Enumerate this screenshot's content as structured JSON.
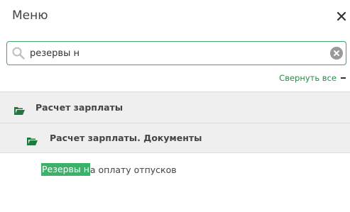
{
  "header": {
    "title": "Меню"
  },
  "icons": {
    "close": "close-icon",
    "search": "search-icon",
    "clear": "clear-icon",
    "folder": "folder-open-icon"
  },
  "search": {
    "value": "резервы н",
    "placeholder": ""
  },
  "collapse": {
    "label": "Свернуть все"
  },
  "tree": {
    "groups": [
      {
        "label": "Расчет зарплаты"
      },
      {
        "label": "Расчет зарплаты. Документы"
      }
    ],
    "result": {
      "highlight": "Резервы н",
      "rest": "а оплату отпусков"
    }
  },
  "colors": {
    "accent": "#3bb26a",
    "link": "#2e8a4e",
    "folder": "#1e7a3c"
  }
}
